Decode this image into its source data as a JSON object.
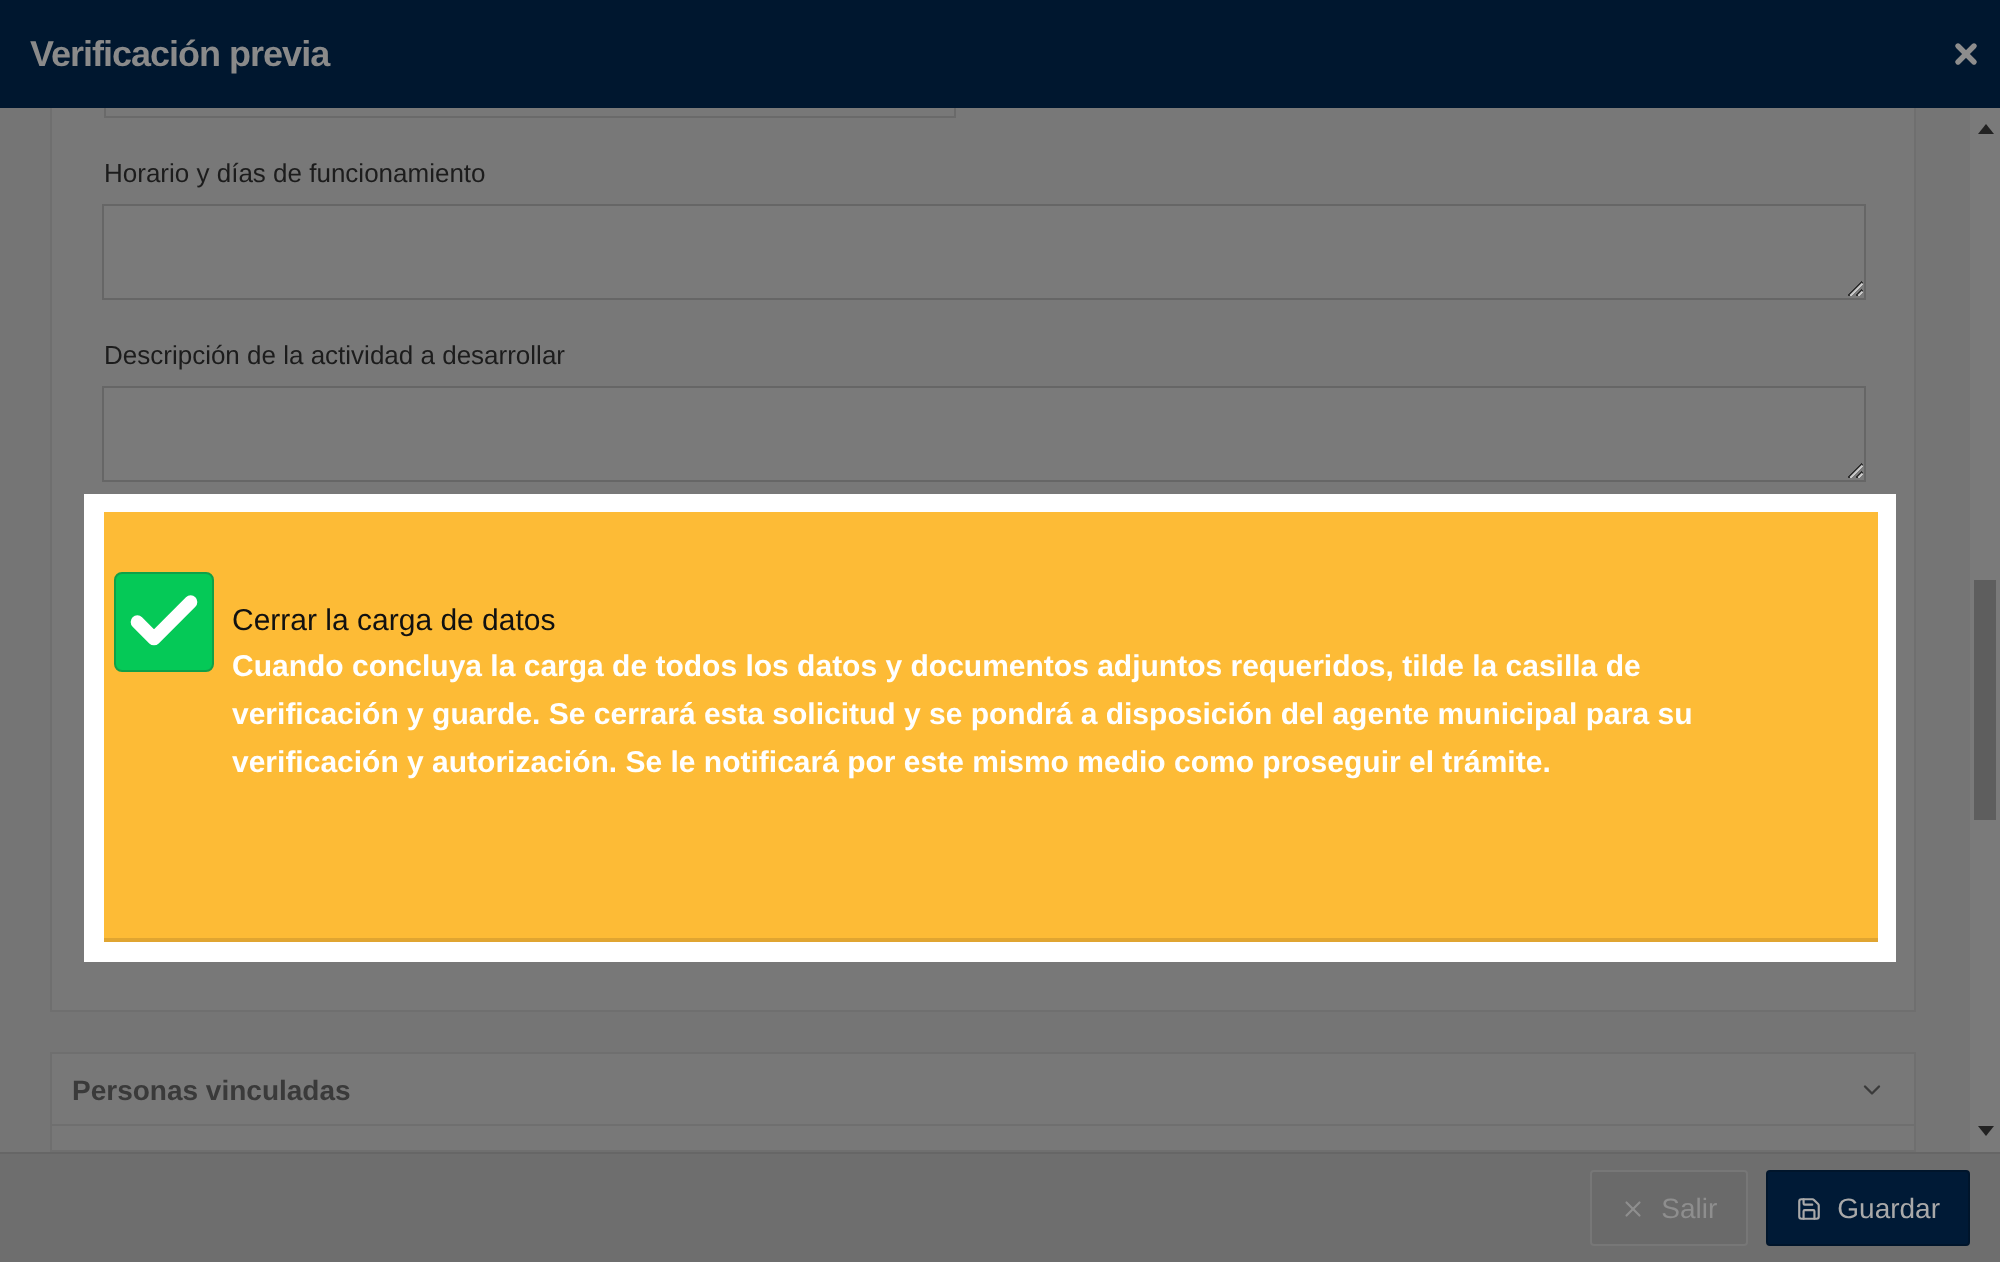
{
  "window": {
    "title": "Verificación previa"
  },
  "fields": [
    {
      "label": "Horario y días de funcionamiento"
    },
    {
      "label": "Descripción de la actividad a desarrollar"
    }
  ],
  "confirm": {
    "checked": true,
    "title": "Cerrar la carga de datos",
    "description": "Cuando concluya la carga de todos los datos y documentos adjuntos requeridos, tilde la casilla de verificación y guarde. Se cerrará esta solicitud y se pondrá a disposición del agente municipal para su verificación y autorización. Se le notificará por este mismo medio como proseguir el trámite."
  },
  "sections": [
    {
      "title": "Personas vinculadas",
      "expanded": false
    }
  ],
  "buttons": [
    {
      "label": "Salir",
      "kind": "exit",
      "disabled": true
    },
    {
      "label": "Guardar",
      "kind": "save",
      "disabled": false
    }
  ]
}
